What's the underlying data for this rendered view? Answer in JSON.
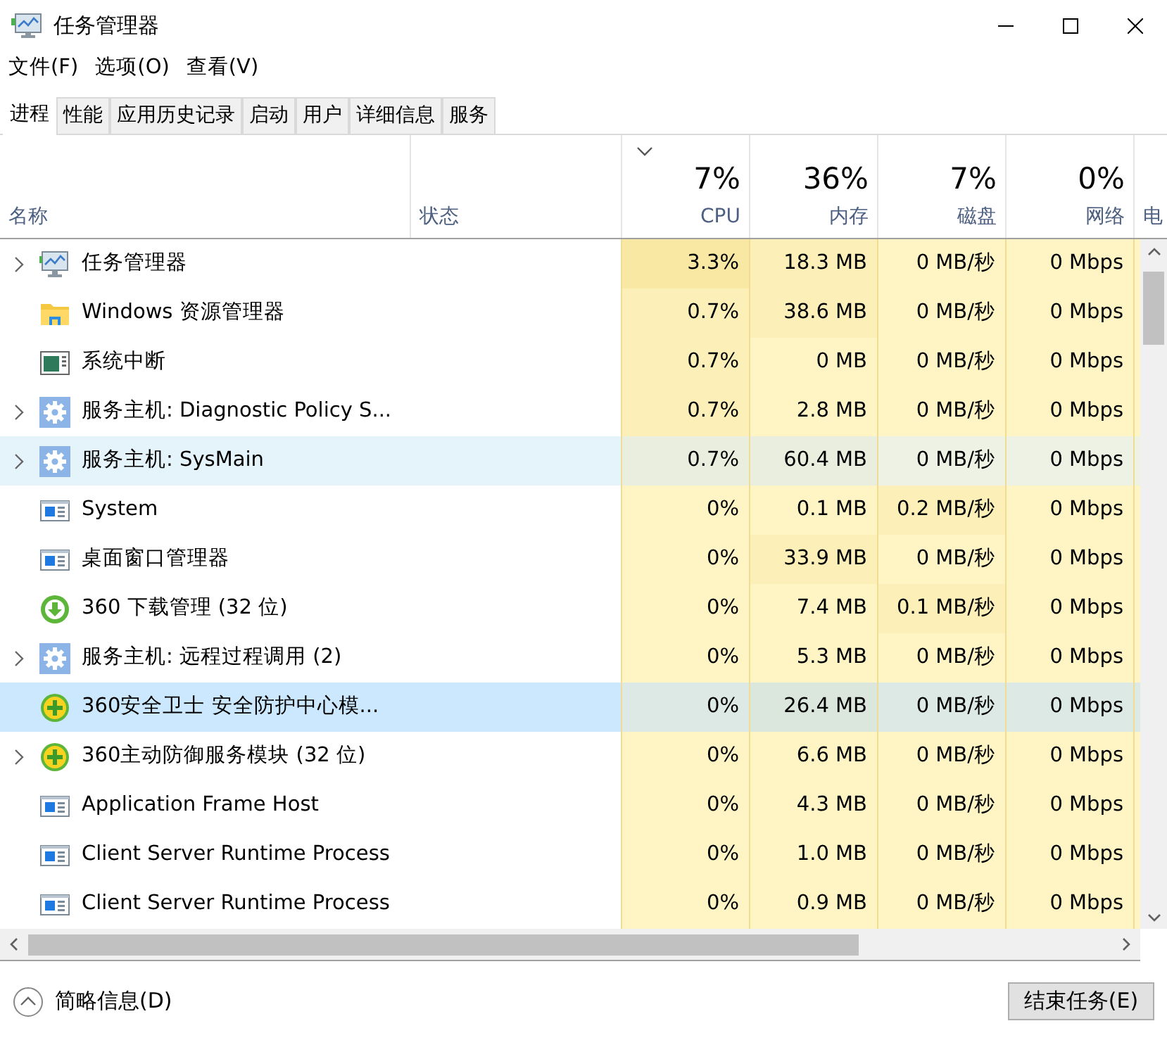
{
  "window": {
    "title": "任务管理器"
  },
  "menu": [
    "文件(F)",
    "选项(O)",
    "查看(V)"
  ],
  "tabs": [
    {
      "label": "进程",
      "selected": true
    },
    {
      "label": "性能",
      "selected": false
    },
    {
      "label": "应用历史记录",
      "selected": false
    },
    {
      "label": "启动",
      "selected": false
    },
    {
      "label": "用户",
      "selected": false
    },
    {
      "label": "详细信息",
      "selected": false
    },
    {
      "label": "服务",
      "selected": false
    }
  ],
  "columns": [
    {
      "label": "名称",
      "sorted": false
    },
    {
      "label": "状态",
      "sorted": false
    },
    {
      "label": "CPU",
      "total": "7%",
      "sorted": true
    },
    {
      "label": "内存",
      "total": "36%",
      "sorted": false
    },
    {
      "label": "磁盘",
      "total": "7%",
      "sorted": false
    },
    {
      "label": "网络",
      "total": "0%",
      "sorted": false
    },
    {
      "label": "电",
      "sorted": false
    }
  ],
  "rows": [
    {
      "name": "任务管理器",
      "kind": "monitor",
      "expandable": true,
      "selected": false,
      "hovered": false,
      "metrics": [
        {
          "text": "3.3%",
          "color": "#f9e8a4"
        },
        {
          "text": "18.3 MB",
          "color": "#fcefb8"
        },
        {
          "text": "0 MB/秒",
          "color": "#fff4c4"
        },
        {
          "text": "0 Mbps",
          "color": "#fff4c4"
        }
      ]
    },
    {
      "name": "Windows 资源管理器",
      "kind": "folder",
      "expandable": false,
      "selected": false,
      "hovered": false,
      "metrics": [
        {
          "text": "0.7%",
          "color": "#fcefb8"
        },
        {
          "text": "38.6 MB",
          "color": "#fcefb8"
        },
        {
          "text": "0 MB/秒",
          "color": "#fff4c4"
        },
        {
          "text": "0 Mbps",
          "color": "#fff4c4"
        }
      ]
    },
    {
      "name": "系统中断",
      "kind": "window-dark",
      "expandable": false,
      "selected": false,
      "hovered": false,
      "metrics": [
        {
          "text": "0.7%",
          "color": "#fcefb8"
        },
        {
          "text": "0 MB",
          "color": "#fff4c4"
        },
        {
          "text": "0 MB/秒",
          "color": "#fff4c4"
        },
        {
          "text": "0 Mbps",
          "color": "#fff4c4"
        }
      ]
    },
    {
      "name": "服务主机: Diagnostic Policy S...",
      "kind": "gear",
      "expandable": true,
      "selected": false,
      "hovered": false,
      "metrics": [
        {
          "text": "0.7%",
          "color": "#fcefb8"
        },
        {
          "text": "2.8 MB",
          "color": "#fff4c4"
        },
        {
          "text": "0 MB/秒",
          "color": "#fff4c4"
        },
        {
          "text": "0 Mbps",
          "color": "#fff4c4"
        }
      ]
    },
    {
      "name": "服务主机: SysMain",
      "kind": "gear",
      "expandable": true,
      "selected": false,
      "hovered": true,
      "metrics": [
        {
          "text": "0.7%",
          "color": "#eaeedf"
        },
        {
          "text": "60.4 MB",
          "color": "#eaeedf"
        },
        {
          "text": "0 MB/秒",
          "color": "#eef2e4"
        },
        {
          "text": "0 Mbps",
          "color": "#eef2e4"
        }
      ]
    },
    {
      "name": "System",
      "kind": "app",
      "expandable": false,
      "selected": false,
      "hovered": false,
      "metrics": [
        {
          "text": "0%",
          "color": "#fff4c4"
        },
        {
          "text": "0.1 MB",
          "color": "#fff4c4"
        },
        {
          "text": "0.2 MB/秒",
          "color": "#fcefb8"
        },
        {
          "text": "0 Mbps",
          "color": "#fff4c4"
        }
      ]
    },
    {
      "name": "桌面窗口管理器",
      "kind": "app",
      "expandable": false,
      "selected": false,
      "hovered": false,
      "metrics": [
        {
          "text": "0%",
          "color": "#fff4c4"
        },
        {
          "text": "33.9 MB",
          "color": "#fcefb8"
        },
        {
          "text": "0 MB/秒",
          "color": "#fff4c4"
        },
        {
          "text": "0 Mbps",
          "color": "#fff4c4"
        }
      ]
    },
    {
      "name": "360 下载管理 (32 位)",
      "kind": "download-360",
      "expandable": false,
      "selected": false,
      "hovered": false,
      "metrics": [
        {
          "text": "0%",
          "color": "#fff4c4"
        },
        {
          "text": "7.4 MB",
          "color": "#fff4c4"
        },
        {
          "text": "0.1 MB/秒",
          "color": "#fcefb8"
        },
        {
          "text": "0 Mbps",
          "color": "#fff4c4"
        }
      ]
    },
    {
      "name": "服务主机: 远程过程调用 (2)",
      "kind": "gear",
      "expandable": true,
      "selected": false,
      "hovered": false,
      "metrics": [
        {
          "text": "0%",
          "color": "#fff4c4"
        },
        {
          "text": "5.3 MB",
          "color": "#fff4c4"
        },
        {
          "text": "0 MB/秒",
          "color": "#fff4c4"
        },
        {
          "text": "0 Mbps",
          "color": "#fff4c4"
        }
      ]
    },
    {
      "name": "360安全卫士 安全防护中心模...",
      "kind": "shield-360",
      "expandable": false,
      "selected": true,
      "hovered": false,
      "metrics": [
        {
          "text": "0%",
          "color": "#dde9e4"
        },
        {
          "text": "26.4 MB",
          "color": "#dbe6dd"
        },
        {
          "text": "0 MB/秒",
          "color": "#dde9e4"
        },
        {
          "text": "0 Mbps",
          "color": "#dde9e4"
        }
      ]
    },
    {
      "name": "360主动防御服务模块 (32 位)",
      "kind": "shield-360",
      "expandable": true,
      "selected": false,
      "hovered": false,
      "metrics": [
        {
          "text": "0%",
          "color": "#fff4c4"
        },
        {
          "text": "6.6 MB",
          "color": "#fff4c4"
        },
        {
          "text": "0 MB/秒",
          "color": "#fff4c4"
        },
        {
          "text": "0 Mbps",
          "color": "#fff4c4"
        }
      ]
    },
    {
      "name": "Application Frame Host",
      "kind": "app",
      "expandable": false,
      "selected": false,
      "hovered": false,
      "metrics": [
        {
          "text": "0%",
          "color": "#fff4c4"
        },
        {
          "text": "4.3 MB",
          "color": "#fff4c4"
        },
        {
          "text": "0 MB/秒",
          "color": "#fff4c4"
        },
        {
          "text": "0 Mbps",
          "color": "#fff4c4"
        }
      ]
    },
    {
      "name": "Client Server Runtime Process",
      "kind": "app",
      "expandable": false,
      "selected": false,
      "hovered": false,
      "metrics": [
        {
          "text": "0%",
          "color": "#fff4c4"
        },
        {
          "text": "1.0 MB",
          "color": "#fff4c4"
        },
        {
          "text": "0 MB/秒",
          "color": "#fff4c4"
        },
        {
          "text": "0 Mbps",
          "color": "#fff4c4"
        }
      ]
    },
    {
      "name": "Client Server Runtime Process",
      "kind": "app",
      "expandable": false,
      "selected": false,
      "hovered": false,
      "metrics": [
        {
          "text": "0%",
          "color": "#fff4c4"
        },
        {
          "text": "0.9 MB",
          "color": "#fff4c4"
        },
        {
          "text": "0 MB/秒",
          "color": "#fff4c4"
        },
        {
          "text": "0 Mbps",
          "color": "#fff4c4"
        }
      ]
    }
  ],
  "footer": {
    "details_toggle": "简略信息(D)",
    "end_task": "结束任务(E)"
  }
}
